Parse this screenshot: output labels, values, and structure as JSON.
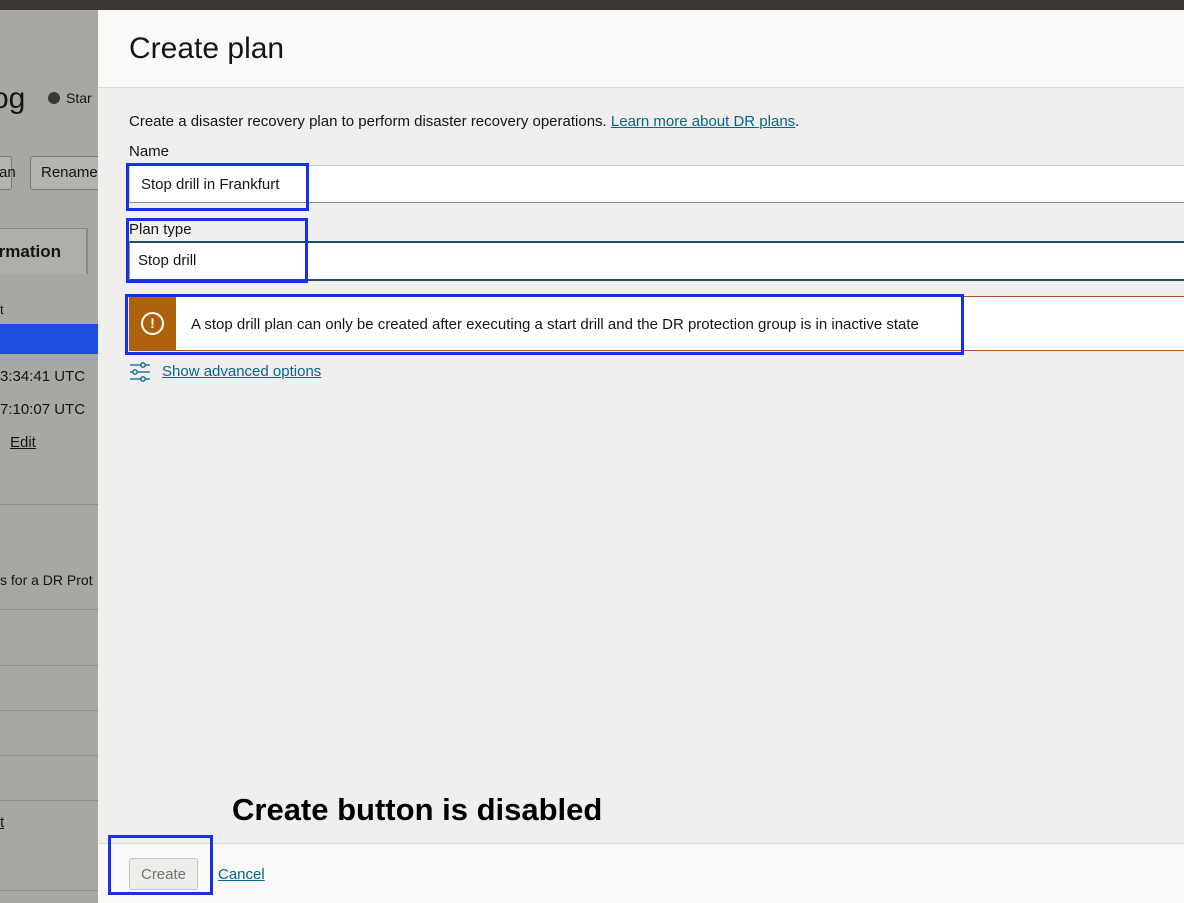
{
  "background_page": {
    "title_fragment": "og",
    "status_fragment": "Star",
    "button_fragment_1": "an",
    "button_fragment_2": "Rename",
    "tab_fragment": "rmation",
    "small_label": "t",
    "timestamp_1": "3:34:41 UTC",
    "timestamp_2": "7:10:07 UTC",
    "edit_link": "Edit",
    "description_fragment": "s for a DR Prot",
    "link_fragment": "t"
  },
  "panel": {
    "title": "Create plan",
    "intro_text": "Create a disaster recovery plan to perform disaster recovery operations. ",
    "intro_link": "Learn more about DR plans",
    "intro_end": ".",
    "name_label": "Name",
    "name_value": "Stop drill in Frankfurt",
    "plan_type_label": "Plan type",
    "plan_type_value": "Stop drill",
    "warning_text": "A stop drill plan can only be created after executing a start drill and the DR protection group is in inactive state",
    "warning_icon": "exclamation-circle-icon",
    "advanced_icon": "sliders-icon",
    "advanced_link": "Show advanced options"
  },
  "annotation": {
    "caption": "Create button is disabled",
    "highlight_color": "#1631e6"
  },
  "footer": {
    "create_label": "Create",
    "create_disabled": true,
    "cancel_label": "Cancel"
  },
  "colors": {
    "link": "#00688c",
    "warning_accent": "#ac630c",
    "warning_border": "#b5541d"
  }
}
